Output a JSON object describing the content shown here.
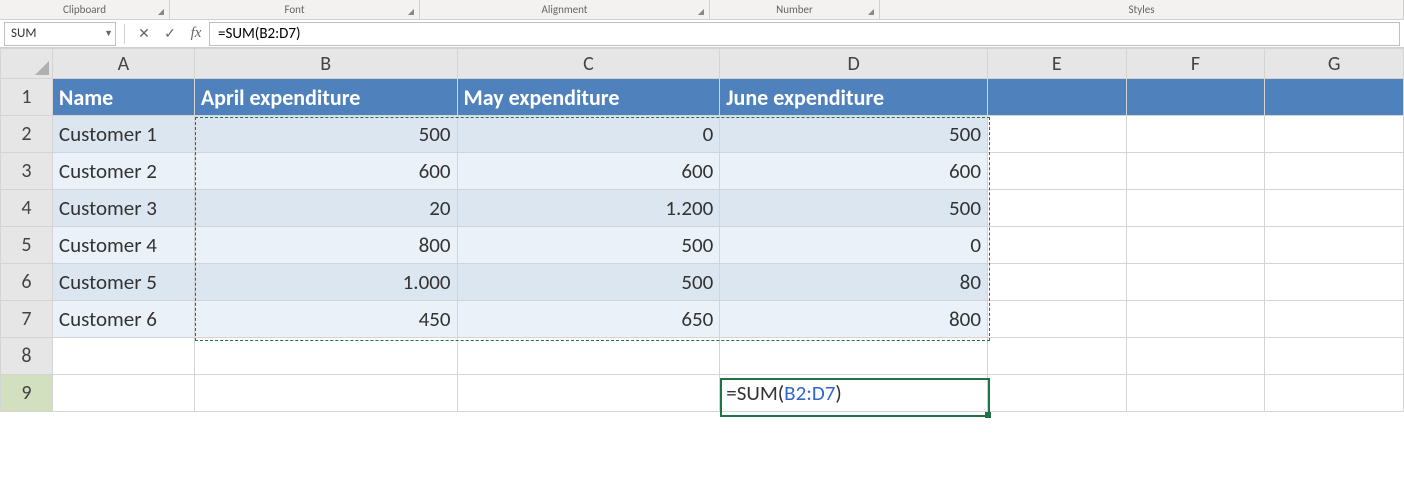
{
  "ribbon": {
    "groups": [
      "Clipboard",
      "Font",
      "Alignment",
      "Number",
      "Styles"
    ]
  },
  "namebox": "SUM",
  "formula_bar": "=SUM(B2:D7)",
  "columns": [
    "A",
    "B",
    "C",
    "D",
    "E",
    "F",
    "G"
  ],
  "row_numbers": [
    "1",
    "2",
    "3",
    "4",
    "5",
    "6",
    "7",
    "8",
    "9"
  ],
  "table": {
    "headers": [
      "Name",
      "April expenditure",
      "May expenditure",
      "June expenditure"
    ],
    "rows": [
      {
        "name": "Customer 1",
        "apr": "500",
        "may": "0",
        "jun": "500"
      },
      {
        "name": "Customer 2",
        "apr": "600",
        "may": "600",
        "jun": "600"
      },
      {
        "name": "Customer 3",
        "apr": "20",
        "may": "1.200",
        "jun": "500"
      },
      {
        "name": "Customer 4",
        "apr": "800",
        "may": "500",
        "jun": "0"
      },
      {
        "name": "Customer 5",
        "apr": "1.000",
        "may": "500",
        "jun": "80"
      },
      {
        "name": "Customer 6",
        "apr": "450",
        "may": "650",
        "jun": "800"
      }
    ]
  },
  "active_cell": {
    "ref": "D9",
    "formula_prefix": "=SUM(",
    "formula_ref": "B2:D7",
    "formula_suffix": ")"
  }
}
